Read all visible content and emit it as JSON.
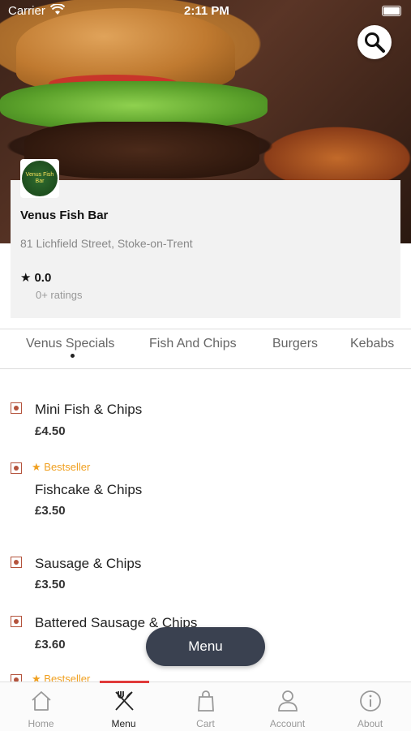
{
  "status_bar": {
    "carrier": "Carrier",
    "time": "2:11 PM"
  },
  "restaurant": {
    "name": "Venus Fish Bar",
    "address": "81 Lichfield Street, Stoke-on-Trent",
    "rating": "0.0",
    "ratings_count": "0+ ratings",
    "logo_text": "Venus Fish Bar"
  },
  "tabs": [
    {
      "label": "Venus Specials",
      "active": true
    },
    {
      "label": "Fish And Chips",
      "active": false
    },
    {
      "label": "Burgers",
      "active": false
    },
    {
      "label": "Kebabs",
      "active": false
    }
  ],
  "items": [
    {
      "name": "Mini Fish & Chips",
      "price": "£4.50",
      "badge": ""
    },
    {
      "name": "Fishcake & Chips",
      "price": "£3.50",
      "badge": "Bestseller"
    },
    {
      "name": "Sausage & Chips",
      "price": "£3.50",
      "badge": ""
    },
    {
      "name": "Battered Sausage & Chips",
      "price": "£3.60",
      "badge": ""
    },
    {
      "name": "",
      "price": "",
      "badge": "Bestseller"
    }
  ],
  "floating_button": {
    "label": "Menu"
  },
  "bottom_nav": [
    {
      "label": "Home",
      "icon": "home-icon",
      "active": false
    },
    {
      "label": "Menu",
      "icon": "fork-knife-icon",
      "active": true
    },
    {
      "label": "Cart",
      "icon": "shopping-bag-icon",
      "active": false
    },
    {
      "label": "Account",
      "icon": "user-icon",
      "active": false
    },
    {
      "label": "About",
      "icon": "info-icon",
      "active": false
    }
  ],
  "colors": {
    "accent": "#e03a3a",
    "veg_marker": "#b4533c",
    "bestseller": "#f0a020",
    "pill": "#3a4150"
  }
}
